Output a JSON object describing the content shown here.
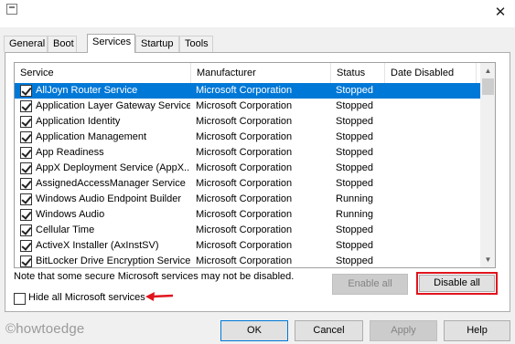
{
  "window": {
    "close_glyph": "✕"
  },
  "tabs": [
    {
      "label": "General"
    },
    {
      "label": "Boot"
    },
    {
      "label": "Services",
      "active": true
    },
    {
      "label": "Startup"
    },
    {
      "label": "Tools"
    }
  ],
  "list": {
    "columns": [
      "Service",
      "Manufacturer",
      "Status",
      "Date Disabled"
    ],
    "rows": [
      {
        "service": "AllJoyn Router Service",
        "manufacturer": "Microsoft Corporation",
        "status": "Stopped",
        "date_disabled": "",
        "checked": true,
        "selected": true
      },
      {
        "service": "Application Layer Gateway Service",
        "manufacturer": "Microsoft Corporation",
        "status": "Stopped",
        "date_disabled": "",
        "checked": true
      },
      {
        "service": "Application Identity",
        "manufacturer": "Microsoft Corporation",
        "status": "Stopped",
        "date_disabled": "",
        "checked": true
      },
      {
        "service": "Application Management",
        "manufacturer": "Microsoft Corporation",
        "status": "Stopped",
        "date_disabled": "",
        "checked": true
      },
      {
        "service": "App Readiness",
        "manufacturer": "Microsoft Corporation",
        "status": "Stopped",
        "date_disabled": "",
        "checked": true
      },
      {
        "service": "AppX Deployment Service (AppX...",
        "manufacturer": "Microsoft Corporation",
        "status": "Stopped",
        "date_disabled": "",
        "checked": true
      },
      {
        "service": "AssignedAccessManager Service",
        "manufacturer": "Microsoft Corporation",
        "status": "Stopped",
        "date_disabled": "",
        "checked": true
      },
      {
        "service": "Windows Audio Endpoint Builder",
        "manufacturer": "Microsoft Corporation",
        "status": "Running",
        "date_disabled": "",
        "checked": true
      },
      {
        "service": "Windows Audio",
        "manufacturer": "Microsoft Corporation",
        "status": "Running",
        "date_disabled": "",
        "checked": true
      },
      {
        "service": "Cellular Time",
        "manufacturer": "Microsoft Corporation",
        "status": "Stopped",
        "date_disabled": "",
        "checked": true
      },
      {
        "service": "ActiveX Installer (AxInstSV)",
        "manufacturer": "Microsoft Corporation",
        "status": "Stopped",
        "date_disabled": "",
        "checked": true
      },
      {
        "service": "BitLocker Drive Encryption Service",
        "manufacturer": "Microsoft Corporation",
        "status": "Stopped",
        "date_disabled": "",
        "checked": true
      }
    ]
  },
  "note": "Note that some secure Microsoft services may not be disabled.",
  "buttons": {
    "enable_all": "Enable all",
    "disable_all": "Disable all",
    "ok": "OK",
    "cancel": "Cancel",
    "apply": "Apply",
    "help": "Help"
  },
  "hide_ms_services": {
    "label": "Hide all Microsoft services",
    "checked": false
  },
  "watermark": "©howtoedge",
  "colors": {
    "selection": "#0078d7",
    "highlight_box": "#e0141e",
    "arrow": "#e0141e"
  },
  "icons": {
    "scroll_up": "▲",
    "scroll_down": "▼"
  }
}
